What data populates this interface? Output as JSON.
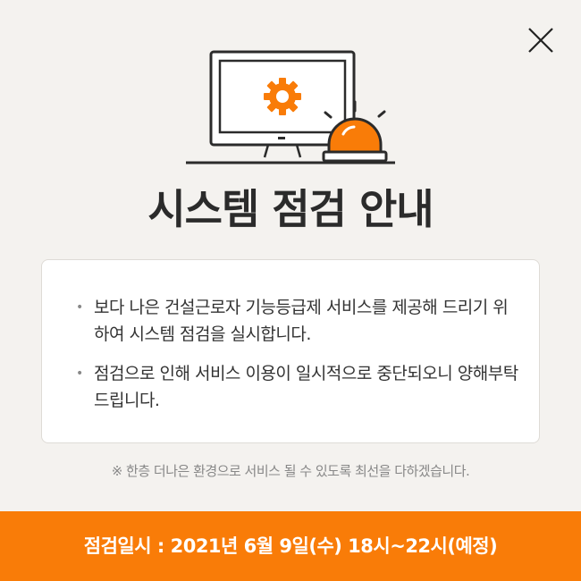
{
  "dialog": {
    "title": "시스템 점검 안내",
    "bullets": [
      "보다 나은 건설근로자 기능등급제 서비스를 제공해 드리기 위하여 시스템 점검을 실시합니다.",
      "점검으로 인해 서비스 이용이 일시적으로 중단되오니 양해부탁드립니다."
    ],
    "note": "※ 한층 더나은 환경으로 서비스 될 수 있도록 최선을 다하겠습니다.",
    "schedule": "점검일시 : 2021년 6월 9일(수) 18시~22시(예정)"
  },
  "colors": {
    "accent": "#f97c08",
    "background": "#f4f2ef",
    "text": "#2b2b2b"
  },
  "icons": {
    "close": "close-icon",
    "illustration": "monitor-gear-alarm-icon"
  }
}
